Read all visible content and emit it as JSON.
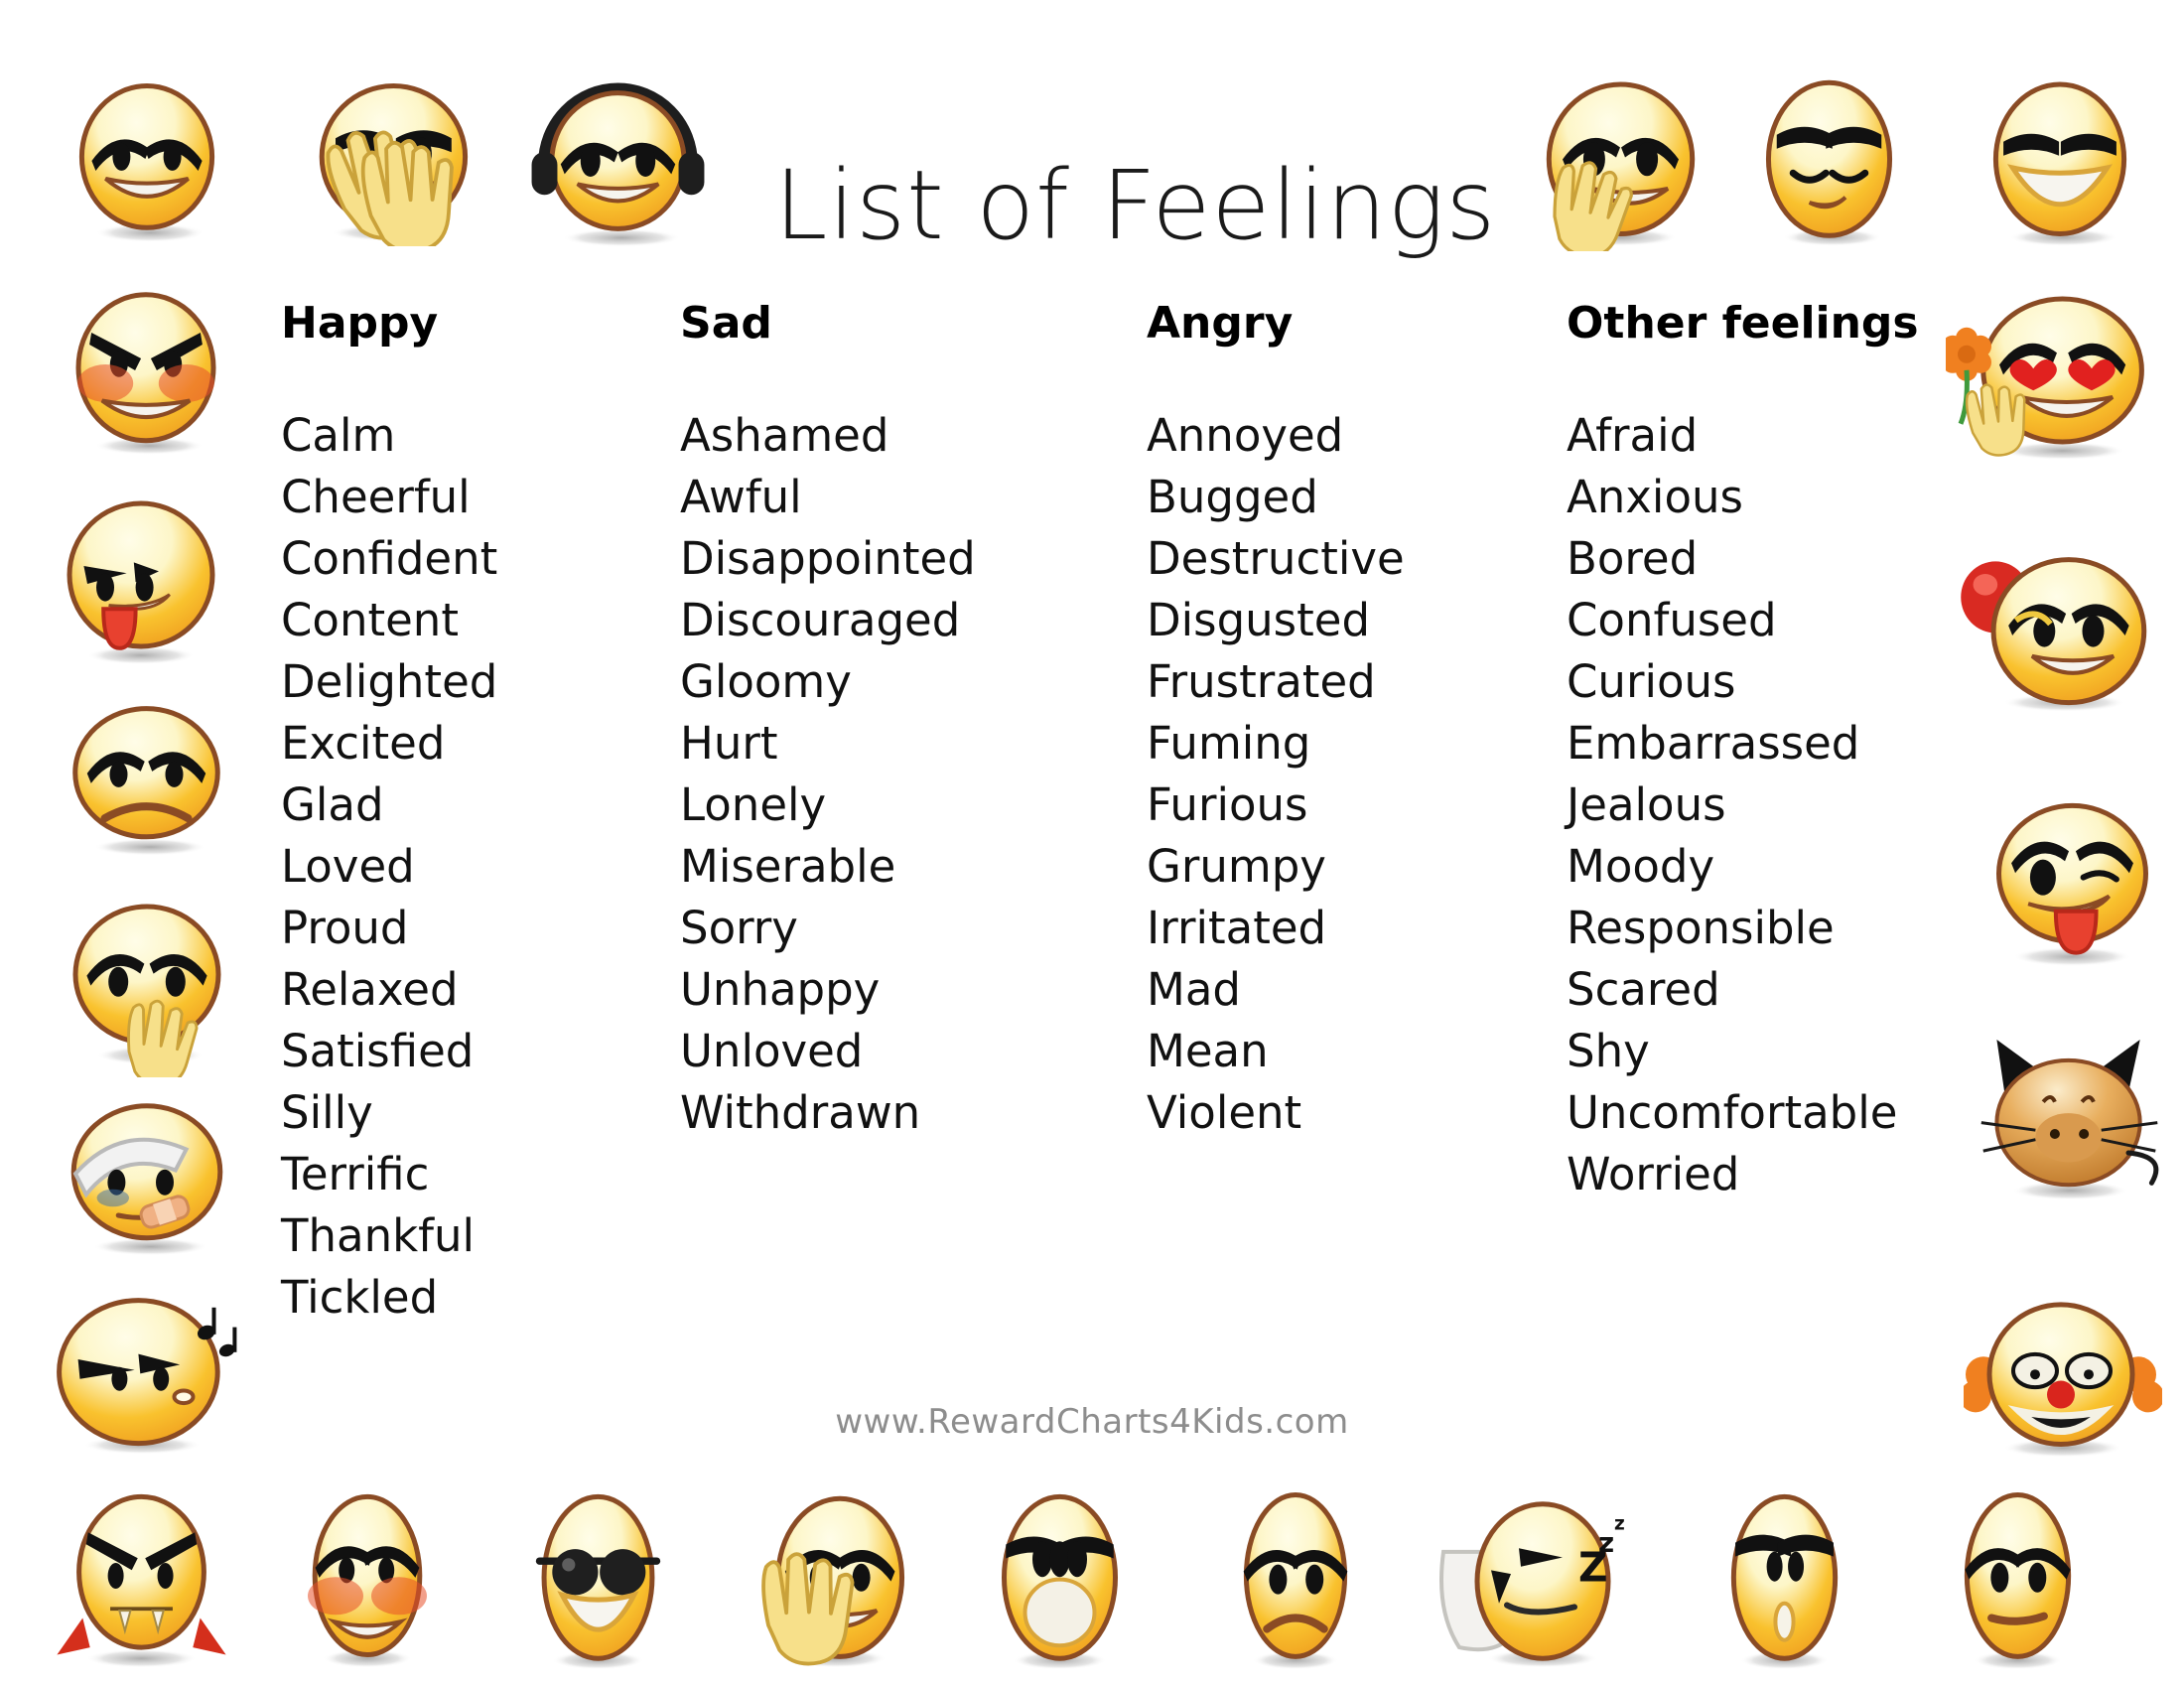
{
  "page": {
    "title": "List of Feelings",
    "footer_url": "www.RewardCharts4Kids.com",
    "background_color": "#ffffff",
    "text_color": "#111111",
    "footer_color": "#8d8d8d",
    "emoji_body_color": "#f9c22e",
    "emoji_outline_color": "#8a4b24",
    "emoji_highlight_color": "#fdf6c8"
  },
  "columns": [
    {
      "header": "Happy",
      "words": [
        "Calm",
        "Cheerful",
        "Confident",
        "Content",
        "Delighted",
        "Excited",
        "Glad",
        "Loved",
        "Proud",
        "Relaxed",
        "Satisfied",
        "Silly",
        "Terrific",
        "Thankful",
        "Tickled"
      ]
    },
    {
      "header": "Sad",
      "words": [
        "Ashamed",
        "Awful",
        "Disappointed",
        "Discouraged",
        "Gloomy",
        "Hurt",
        "Lonely",
        "Miserable",
        "Sorry",
        "Unhappy",
        "Unloved",
        "Withdrawn"
      ]
    },
    {
      "header": "Angry",
      "words": [
        "Annoyed",
        "Bugged",
        "Destructive",
        "Disgusted",
        "Frustrated",
        "Fuming",
        "Furious",
        "Grumpy",
        "Irritated",
        "Mad",
        "Mean",
        "Violent"
      ]
    },
    {
      "header": "Other feelings",
      "words": [
        "Afraid",
        "Anxious",
        "Bored",
        "Confused",
        "Curious",
        "Embarrassed",
        "Jealous",
        "Moody",
        "Responsible",
        "Scared",
        "Shy",
        "Uncomfortable",
        "Worried"
      ]
    }
  ],
  "decorations": {
    "top_row": [
      "grinning-raised-brows-smiley-icon",
      "facepalm-smiley-icon",
      "headphones-music-smiley-icon"
    ],
    "top_right_row": [
      "thinking-hand-on-chin-smiley-icon",
      "sleepy-sad-smiley-icon",
      "big-grin-smiley-icon"
    ],
    "left_column": [
      "blushing-smiley-icon",
      "tongue-out-yuck-smiley-icon",
      "frowning-sad-smiley-icon",
      "thinking-finger-to-mouth-smiley-icon",
      "bandaged-injured-smiley-icon",
      "whistling-music-smiley-icon"
    ],
    "right_column": [
      "heart-eyes-flower-smiley-icon",
      "balloon-smiley-icon",
      "winking-tongue-out-smiley-icon",
      "cat-face-smiley-icon",
      "clown-smiley-icon"
    ],
    "bottom_row": [
      "angry-vampire-smiley-icon",
      "blushing-embarrassed-smiley-icon",
      "sunglasses-cool-smiley-icon",
      "waving-hand-smiley-icon",
      "shocked-open-mouth-smiley-icon",
      "sad-frown-smiley-icon",
      "sleeping-pillow-smiley-icon",
      "surprised-smiley-icon",
      "neutral-worried-smiley-icon"
    ]
  }
}
